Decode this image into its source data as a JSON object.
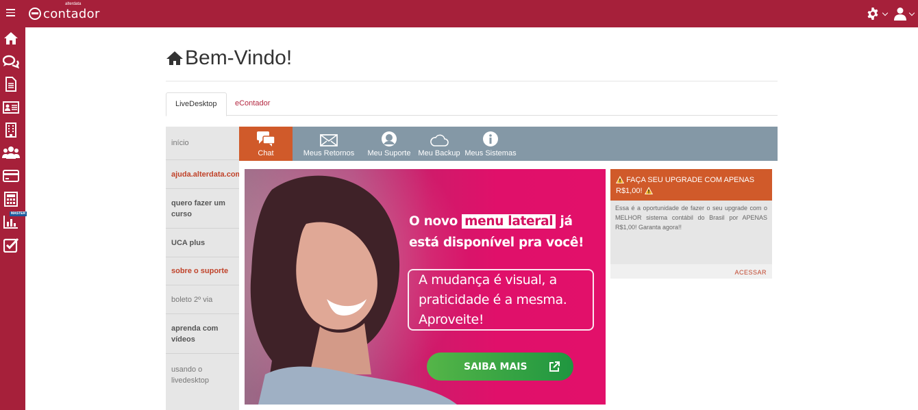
{
  "app": {
    "logo_text": "contador",
    "logo_sub": "alterdata"
  },
  "page": {
    "title": "Bem-Vindo!"
  },
  "tabs": [
    {
      "label": "LiveDesktop",
      "active": true
    },
    {
      "label": "eContador",
      "active": false
    }
  ],
  "left_menu": [
    {
      "label": "início",
      "style": "gray"
    },
    {
      "label": "ajuda.alterdata.com.br",
      "style": "red"
    },
    {
      "label": "quero fazer um curso",
      "style": "bold"
    },
    {
      "label": "UCA plus",
      "style": "bold"
    },
    {
      "label": "sobre o suporte",
      "style": "red"
    },
    {
      "label": "boleto 2º via",
      "style": "gray"
    },
    {
      "label": "aprenda com vídeos",
      "style": "bold"
    },
    {
      "label": "usando o livedesktop",
      "style": "gray"
    }
  ],
  "app_bar": [
    {
      "label": "Chat",
      "icon": "chat-icon",
      "active": true
    },
    {
      "label": "Meus Retornos",
      "icon": "envelope-icon",
      "active": false
    },
    {
      "label": "Meu Suporte",
      "icon": "user-icon",
      "active": false
    },
    {
      "label": "Meu Backup",
      "icon": "cloud-icon",
      "active": false
    },
    {
      "label": "Meus Sistemas",
      "icon": "info-icon",
      "active": false
    }
  ],
  "banner": {
    "line1_pre": "O novo ",
    "line1_mark": "menu lateral",
    "line1_post": " já",
    "line2": "está disponível pra você!",
    "box_lines": [
      "A mudança é visual, a",
      "praticidade é a mesma.",
      "Aproveite!"
    ],
    "cta": "SAIBA MAIS"
  },
  "upgrade_card": {
    "title_a": "FAÇA SEU UPGRADE COM APENAS",
    "title_b": "R$1,00!",
    "body": "Essa é a oportunidade de fazer o seu upgrade com o MELHOR sistema contábil do Brasil por APENAS R$1,00! Garanta agora!!",
    "action": "ACESSAR"
  },
  "rail": {
    "badge": "MASTER",
    "items": [
      "home-icon",
      "chat-icon",
      "document-icon",
      "id-card-icon",
      "building-icon",
      "users-icon",
      "credit-card-icon",
      "calculator-icon",
      "bar-chart-icon",
      "checkbox-icon"
    ]
  },
  "colors": {
    "brand": "#a6203a",
    "accent": "#d05a2a",
    "appbar": "#8498a6",
    "cta_green": "#3aa644"
  }
}
